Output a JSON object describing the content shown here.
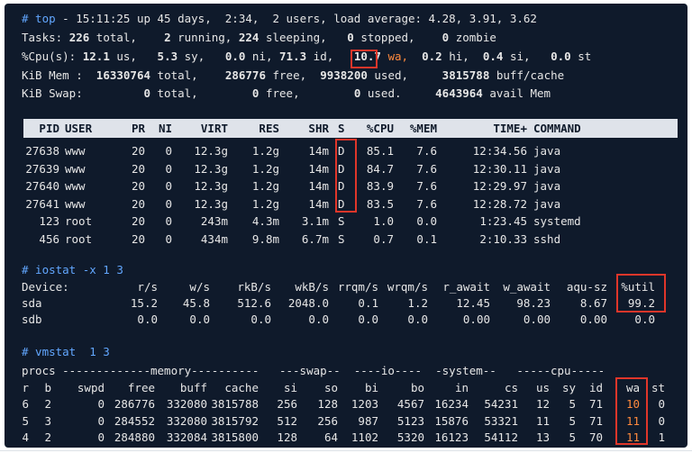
{
  "top": {
    "prompt": "# top",
    "uptime_line": " - 15:11:25 up 45 days,  2:34,  2 users, load average: 4.28, 3.91, 3.62",
    "tasks": {
      "label": "Tasks:",
      "total": "226",
      "total_lbl": " total,",
      "running": "2",
      "running_lbl": " running,",
      "sleeping": "224",
      "sleeping_lbl": " sleeping,",
      "stopped": "0",
      "stopped_lbl": " stopped,",
      "zombie": "0",
      "zombie_lbl": " zombie"
    },
    "cpu": {
      "label": "%Cpu(s):",
      "us": "12.1",
      "us_lbl": " us,",
      "sy": "5.3",
      "sy_lbl": " sy,",
      "ni": "0.0",
      "ni_lbl": " ni,",
      "id": "71.3",
      "id_lbl": " id,",
      "wa": "10.7",
      "wa_lbl": "wa,",
      "hi": "0.2",
      "hi_lbl": " hi,",
      "si": "0.4",
      "si_lbl": " si,",
      "st": "0.0",
      "st_lbl": " st"
    },
    "mem": {
      "label": "KiB Mem :",
      "total": "16330764",
      "total_lbl": " total,",
      "free": "286776",
      "free_lbl": " free,",
      "used": "9938200",
      "used_lbl": " used,",
      "cache": "3815788",
      "cache_lbl": " buff/cache"
    },
    "swap": {
      "label": "KiB Swap:",
      "total": "0",
      "total_lbl": " total,",
      "free": "0",
      "free_lbl": " free,",
      "used": "0",
      "used_lbl": " used.",
      "avail": "4643964",
      "avail_lbl": " avail Mem"
    }
  },
  "proc_table": {
    "headers": [
      "PID",
      "USER",
      "PR",
      "NI",
      "VIRT",
      "RES",
      "SHR",
      "S",
      "%CPU",
      "%MEM",
      "TIME+",
      "COMMAND"
    ],
    "rows": [
      [
        "27638",
        "www",
        "20",
        "0",
        "12.3g",
        "1.2g",
        "14m",
        "D",
        "85.1",
        "7.6",
        "12:34.56",
        "java"
      ],
      [
        "27639",
        "www",
        "20",
        "0",
        "12.3g",
        "1.2g",
        "14m",
        "D",
        "84.7",
        "7.6",
        "12:30.11",
        "java"
      ],
      [
        "27640",
        "www",
        "20",
        "0",
        "12.3g",
        "1.2g",
        "14m",
        "D",
        "83.9",
        "7.6",
        "12:29.97",
        "java"
      ],
      [
        "27641",
        "www",
        "20",
        "0",
        "12.3g",
        "1.2g",
        "14m",
        "D",
        "83.5",
        "7.6",
        "12:28.72",
        "java"
      ],
      [
        "123",
        "root",
        "20",
        "0",
        "243m",
        "4.3m",
        "3.1m",
        "S",
        "1.0",
        "0.0",
        "1:23.45",
        "systemd"
      ],
      [
        "456",
        "root",
        "20",
        "0",
        "434m",
        "9.8m",
        "6.7m",
        "S",
        "0.7",
        "0.1",
        "2:10.33",
        "sshd"
      ]
    ]
  },
  "iostat": {
    "prompt": "# iostat -x 1 3",
    "headers": [
      "Device:",
      "r/s",
      "w/s",
      "rkB/s",
      "wkB/s",
      "rrqm/s",
      "wrqm/s",
      "r_await",
      "w_await",
      "aqu-sz",
      "%util"
    ],
    "rows": [
      [
        "sda",
        "15.2",
        "45.8",
        "512.6",
        "2048.0",
        "0.1",
        "1.2",
        "12.45",
        "98.23",
        "8.67",
        "99.2"
      ],
      [
        "sdb",
        "0.0",
        "0.0",
        "0.0",
        "0.0",
        "0.0",
        "0.0",
        "0.00",
        "0.00",
        "0.00",
        "0.0"
      ]
    ]
  },
  "vmstat": {
    "prompt": "# vmstat  1 3",
    "group_header": "procs -------------memory----------   ---swap--  ----io----  -system--   -----cpu-----",
    "headers": [
      "r",
      "b",
      "swpd",
      "free",
      "buff",
      "cache",
      "si",
      "so",
      "bi",
      "bo",
      "in",
      "cs",
      "us",
      "sy",
      "id",
      "wa",
      "st"
    ],
    "rows": [
      [
        "6",
        "2",
        "0",
        "286776",
        "332080",
        "3815788",
        "256",
        "128",
        "1203",
        "4567",
        "16234",
        "54231",
        "12",
        "5",
        "71",
        "10",
        "0"
      ],
      [
        "5",
        "3",
        "0",
        "284552",
        "332080",
        "3815792",
        "512",
        "256",
        "987",
        "5123",
        "15876",
        "53321",
        "11",
        "5",
        "71",
        "11",
        "0"
      ],
      [
        "4",
        "2",
        "0",
        "284880",
        "332084",
        "3815800",
        "128",
        "64",
        "1102",
        "5320",
        "16123",
        "54112",
        "13",
        "5",
        "70",
        "11",
        "1"
      ]
    ]
  },
  "colors": {
    "background": "#0f1a2b",
    "text": "#e6e6e6",
    "prompt": "#62a7ff",
    "highlight_box": "#e0362a",
    "wa_value": "#ff8a3d",
    "header_bar": "#dfe3ea"
  }
}
